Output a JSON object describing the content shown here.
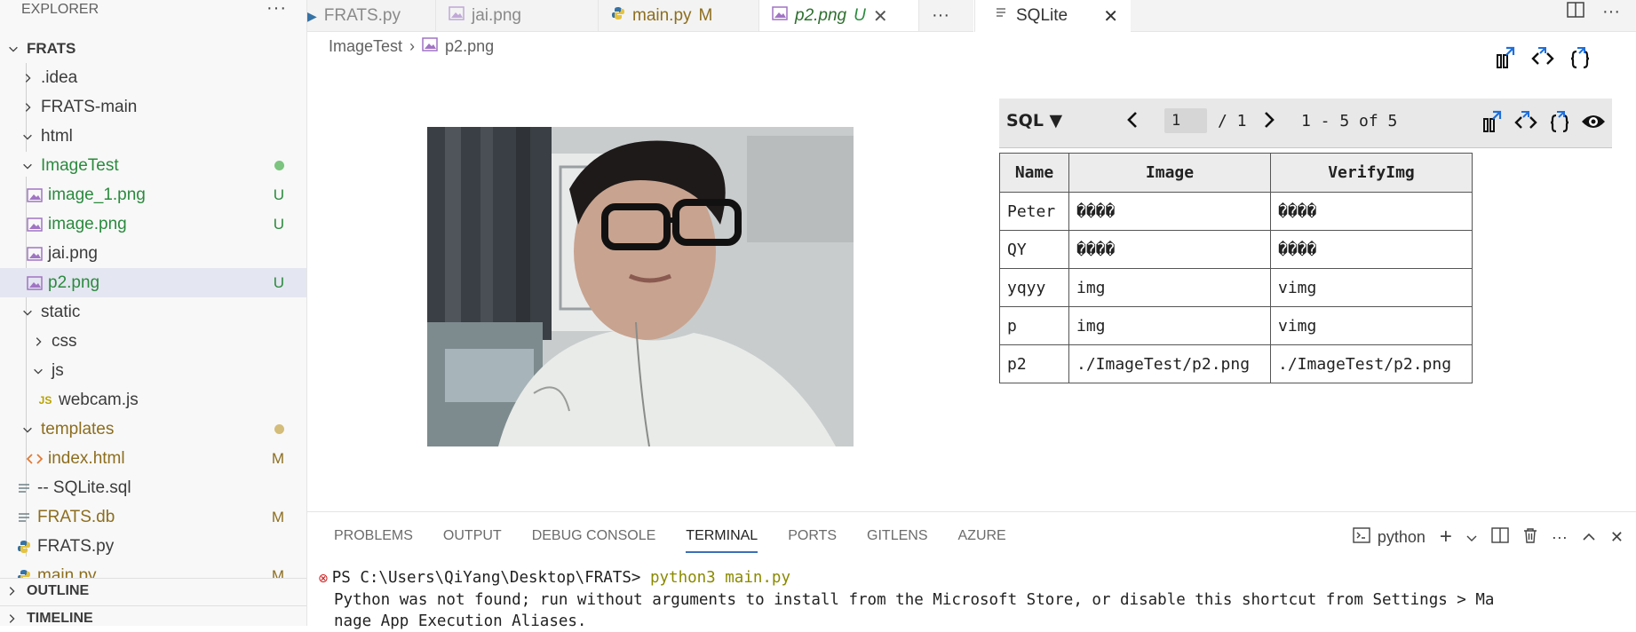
{
  "sidebar": {
    "title": "EXPLORER",
    "root": "FRATS",
    "items": [
      {
        "label": ".idea"
      },
      {
        "label": "FRATS-main"
      },
      {
        "label": "html"
      },
      {
        "label": "ImageTest"
      },
      {
        "label": "image_1.png",
        "badge": "U"
      },
      {
        "label": "image.png",
        "badge": "U"
      },
      {
        "label": "jai.png"
      },
      {
        "label": "p2.png",
        "badge": "U"
      },
      {
        "label": "static"
      },
      {
        "label": "css"
      },
      {
        "label": "js"
      },
      {
        "label": "webcam.js",
        "icon_text": "JS"
      },
      {
        "label": "templates"
      },
      {
        "label": "index.html",
        "badge": "M"
      },
      {
        "label": "-- SQLite.sql"
      },
      {
        "label": "FRATS.db",
        "badge": "M"
      },
      {
        "label": "FRATS.py"
      },
      {
        "label": "main.py",
        "badge": "M"
      }
    ],
    "sections": [
      "OUTLINE",
      "TIMELINE"
    ]
  },
  "editor": {
    "tabs": [
      {
        "label": "FRATS.py"
      },
      {
        "label": "jai.png"
      },
      {
        "label": "main.py",
        "badge": "M"
      },
      {
        "label": "p2.png",
        "badge": "U"
      }
    ],
    "breadcrumb": [
      "ImageTest",
      "p2.png"
    ]
  },
  "sqlite": {
    "tab_label": "SQLite",
    "sql_button": "SQL ▼",
    "page": "1",
    "of_pages": "/ 1",
    "range": "1 - 5 of 5",
    "columns": [
      "Name",
      "Image",
      "VerifyImg"
    ],
    "rows": [
      [
        "Peter",
        "����",
        "����"
      ],
      [
        "QY",
        "����",
        "����"
      ],
      [
        "yqyy",
        "img",
        "vimg"
      ],
      [
        "p",
        "img",
        "vimg"
      ],
      [
        "p2",
        "./ImageTest/p2.png",
        "./ImageTest/p2.png"
      ]
    ]
  },
  "panel": {
    "tabs": [
      "PROBLEMS",
      "OUTPUT",
      "DEBUG CONSOLE",
      "TERMINAL",
      "PORTS",
      "GITLENS",
      "AZURE"
    ],
    "active_tab": "TERMINAL",
    "shell": "python",
    "terminal": {
      "prompt": "PS C:\\Users\\QiYang\\Desktop\\FRATS> ",
      "command": "python3 main.py",
      "line2": "Python was not found; run without arguments to install from the Microsoft Store, or disable this shortcut from Settings > Ma",
      "line3": "nage App Execution Aliases."
    }
  },
  "colors": {
    "untracked": "#2b8a3e",
    "modified": "#8d6e1f",
    "selection": "#e4e6f1",
    "accent": "#3b6fb6"
  }
}
